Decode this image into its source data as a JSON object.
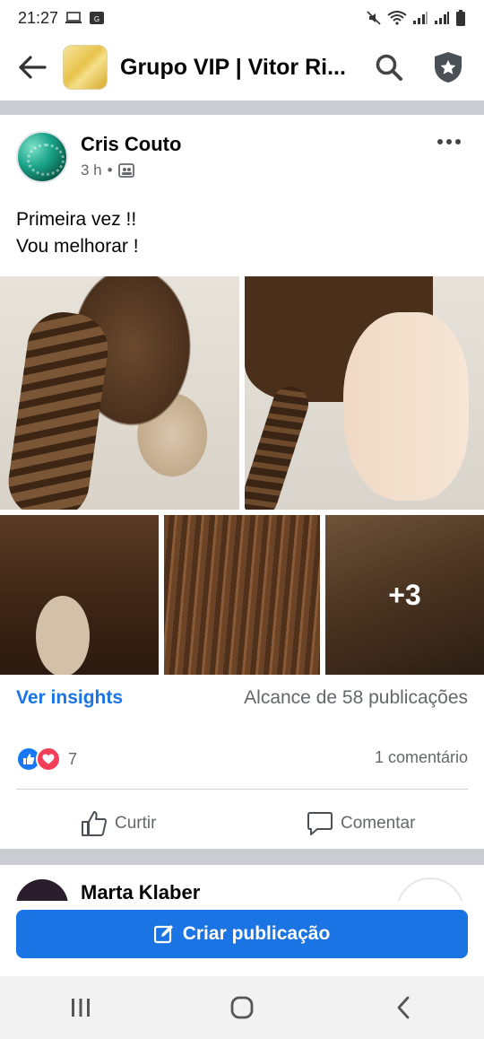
{
  "status_bar": {
    "time": "21:27"
  },
  "header": {
    "title": "Grupo VIP | Vitor Ri..."
  },
  "post": {
    "author": "Cris Couto",
    "time": "3 h",
    "meta_separator": "•",
    "text": "Primeira vez !!\nVou melhorar !",
    "more_photos": "+3",
    "insights_label": "Ver insights",
    "reach_label": "Alcance de 58 publicações",
    "reactions_count": "7",
    "comments_label": "1 comentário",
    "like_label": "Curtir",
    "comment_label": "Comentar"
  },
  "next_post": {
    "author": "Marta Klaber"
  },
  "create_post": {
    "label": "Criar publicação"
  },
  "colors": {
    "accent": "#1b74e4",
    "like": "#1877f2",
    "love": "#f33e58",
    "separator": "#c9ccd1"
  },
  "icons": [
    "back-arrow-icon",
    "search-icon",
    "shield-star-icon",
    "group-privacy-icon",
    "more-options-icon",
    "like-reaction-icon",
    "love-reaction-icon",
    "thumbs-up-icon",
    "comment-icon",
    "edit-icon",
    "recent-apps-icon",
    "home-icon",
    "back-nav-icon"
  ]
}
